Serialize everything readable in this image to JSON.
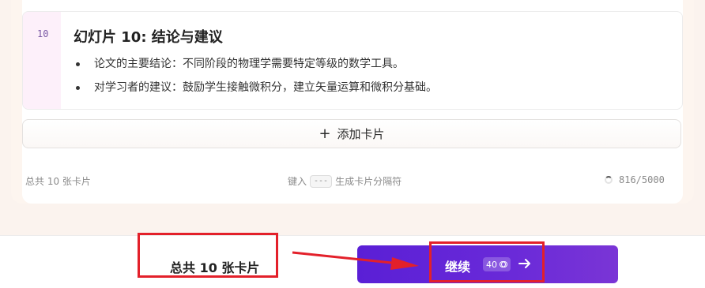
{
  "slide": {
    "number": "10",
    "title": "幻灯片 10: 结论与建议",
    "bullets": [
      "论文的主要结论：不同阶段的物理学需要特定等级的数学工具。",
      "对学习者的建议：鼓励学生接触微积分，建立矢量运算和微积分基础。"
    ]
  },
  "add_card": {
    "icon": "plus-icon",
    "label": "添加卡片"
  },
  "footer": {
    "card_count": "总共 10 张卡片",
    "hint_prefix": "键入",
    "hint_key": "---",
    "hint_suffix": "生成卡片分隔符",
    "char_count": "816/5000"
  },
  "bottom": {
    "total_cards": "总共 10 张卡片",
    "continue_label": "继续",
    "credits": "40",
    "credit_icon": "coin-icon",
    "arrow_icon": "arrow-right-icon"
  },
  "colors": {
    "accent": "#5a1fd6",
    "annotation_red": "#e3202a",
    "slide_number_bg": "#fdf0fa"
  }
}
